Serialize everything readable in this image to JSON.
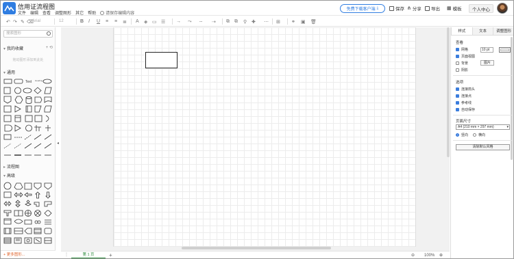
{
  "app": {
    "title": "信用证流程图",
    "menu": [
      "文件",
      "编辑",
      "查看",
      "调整图形",
      "其它",
      "帮助"
    ],
    "save_hint": "请保存编辑内容"
  },
  "header": {
    "download_label": "免费下载客户端",
    "save_label": "保存",
    "share_label": "分享",
    "export_label": "导出",
    "template_label": "模板",
    "profile_label": "个人中心"
  },
  "toolbar": {
    "font_family": "Arial",
    "font_size": "12",
    "bold": "B",
    "italic": "I",
    "underline": "U"
  },
  "sidebar": {
    "search_placeholder": "搜索图形",
    "favorites_title": "我的收藏",
    "favorites_actions": "+ ⟲",
    "drop_hint": "拖动图形添加到此处",
    "general_title": "通用",
    "flowchart_title": "流程图",
    "advanced_title": "高级",
    "more_shapes": "+ 更多图形..."
  },
  "canvas": {
    "page_tab": "第 1 页",
    "add_page": "+",
    "zoom": "100%"
  },
  "right_panel": {
    "tabs": [
      "样式",
      "文本",
      "调整图形"
    ],
    "view_title": "查看",
    "grid_label": "网格",
    "grid_size": "10 pt",
    "page_view_label": "页面视图",
    "background_label": "背景",
    "image_button": "图片",
    "shadow_label": "阴影",
    "options_title": "选项",
    "connection_arrows_label": "连接箭头",
    "connection_points_label": "连接点",
    "guides_label": "参考线",
    "autosave_label": "自动保存",
    "paper_title": "页面尺寸",
    "paper_value": "A4 (210 mm × 297 mm)",
    "portrait_label": "竖向",
    "landscape_label": "横向",
    "reset_button": "清除默认风格"
  },
  "colors": {
    "accent": "#2f7de1",
    "page_tab": "#2a8a3a",
    "more_shapes": "#e0642b",
    "checkbox_on": "#3b7ddd"
  }
}
